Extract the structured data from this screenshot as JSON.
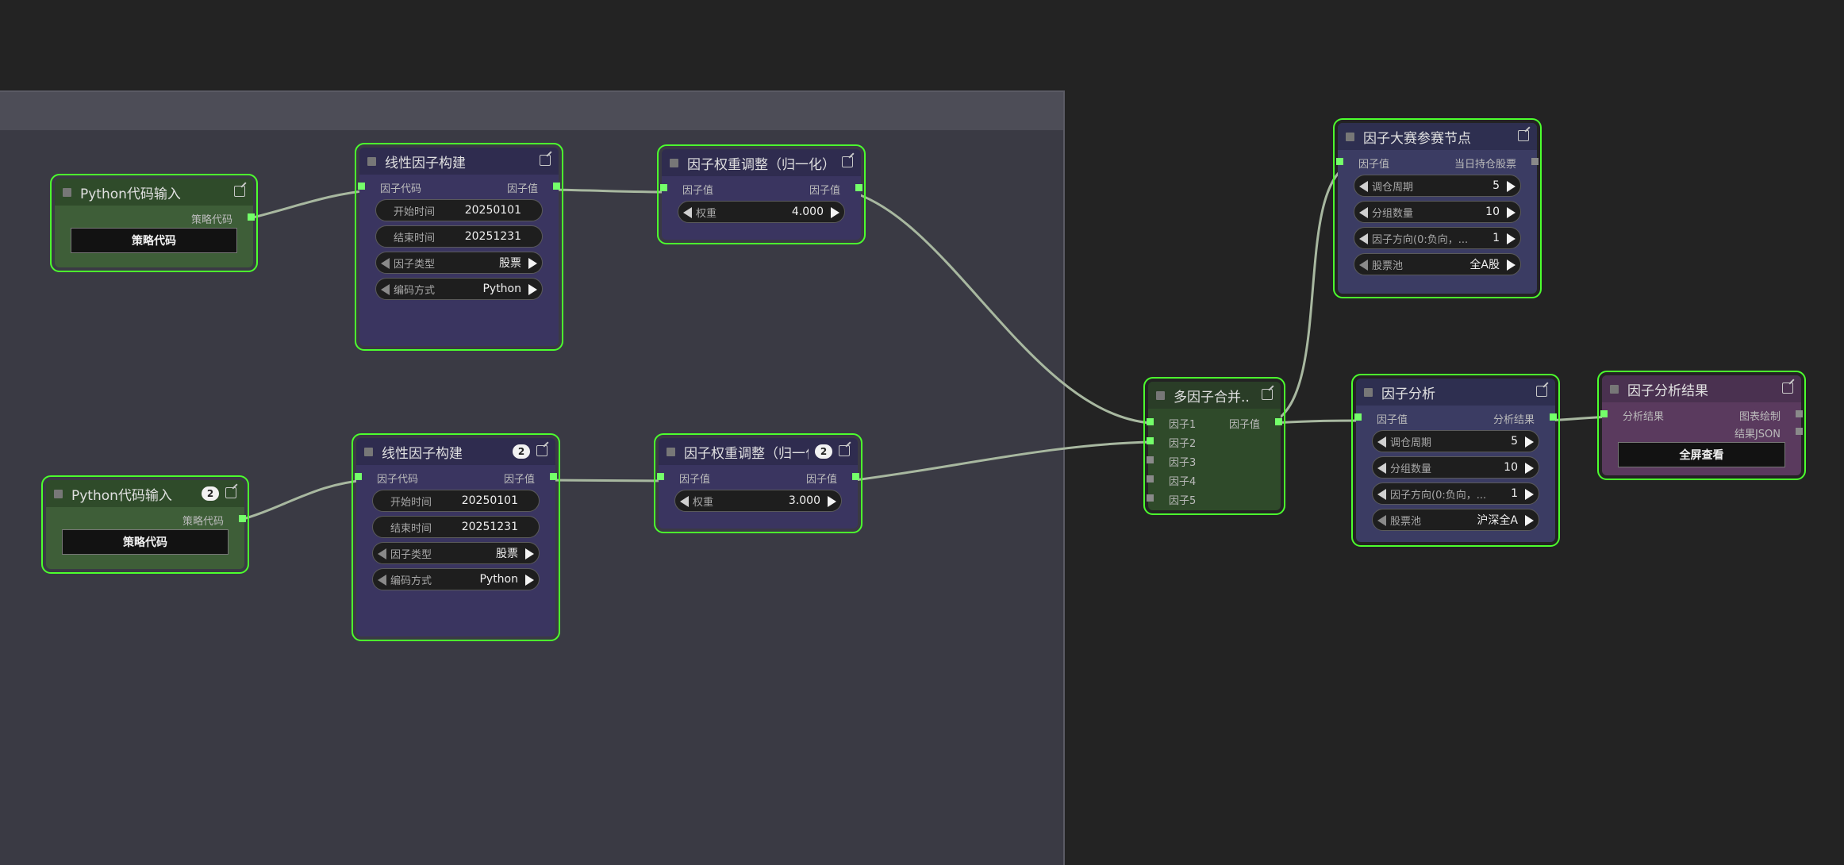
{
  "nodes": {
    "py1": {
      "title": "Python代码输入",
      "out_label": "策略代码",
      "button": "策略代码"
    },
    "py2": {
      "title": "Python代码输入",
      "badge": "2",
      "out_label": "策略代码",
      "button": "策略代码"
    },
    "lin1": {
      "title": "线性因子构建",
      "in_label": "因子代码",
      "out_label": "因子值",
      "start_label": "开始时间",
      "start_value": "20250101",
      "end_label": "结束时间",
      "end_value": "20251231",
      "type_label": "因子类型",
      "type_value": "股票",
      "enc_label": "编码方式",
      "enc_value": "Python"
    },
    "lin2": {
      "title": "线性因子构建",
      "badge": "2",
      "in_label": "因子代码",
      "out_label": "因子值",
      "start_label": "开始时间",
      "start_value": "20250101",
      "end_label": "结束时间",
      "end_value": "20251231",
      "type_label": "因子类型",
      "type_value": "股票",
      "enc_label": "编码方式",
      "enc_value": "Python"
    },
    "w1": {
      "title": "因子权重调整（归一化）",
      "in_label": "因子值",
      "out_label": "因子值",
      "weight_label": "权重",
      "weight_value": "4.000"
    },
    "w2": {
      "title": "因子权重调整（归一化）",
      "badge": "2",
      "in_label": "因子值",
      "out_label": "因子值",
      "weight_label": "权重",
      "weight_value": "3.000"
    },
    "merge": {
      "title": "多因子合并...",
      "out_label": "因子值",
      "inputs": [
        "因子1",
        "因子2",
        "因子3",
        "因子4",
        "因子5"
      ]
    },
    "contest": {
      "title": "因子大赛参赛节点",
      "in_label": "因子值",
      "out_label": "当日持仓股票",
      "period_label": "调仓周期",
      "period_value": "5",
      "groups_label": "分组数量",
      "groups_value": "10",
      "dir_label": "因子方向(0:负向，...",
      "dir_value": "1",
      "pool_label": "股票池",
      "pool_value": "全A股"
    },
    "analysis": {
      "title": "因子分析",
      "in_label": "因子值",
      "out_label": "分析结果",
      "period_label": "调仓周期",
      "period_value": "5",
      "groups_label": "分组数量",
      "groups_value": "10",
      "dir_label": "因子方向(0:负向，...",
      "dir_value": "1",
      "pool_label": "股票池",
      "pool_value": "沪深全A"
    },
    "result": {
      "title": "因子分析结果",
      "in_label": "分析结果",
      "out1_label": "图表绘制",
      "out2_label": "结果JSON",
      "button": "全屏查看"
    }
  },
  "colors": {
    "node_border": "#4cff2e",
    "slot_active": "#74ff6a",
    "wire": "#a8b8a0",
    "canvas": "#232323",
    "group": "#3a3a44"
  }
}
